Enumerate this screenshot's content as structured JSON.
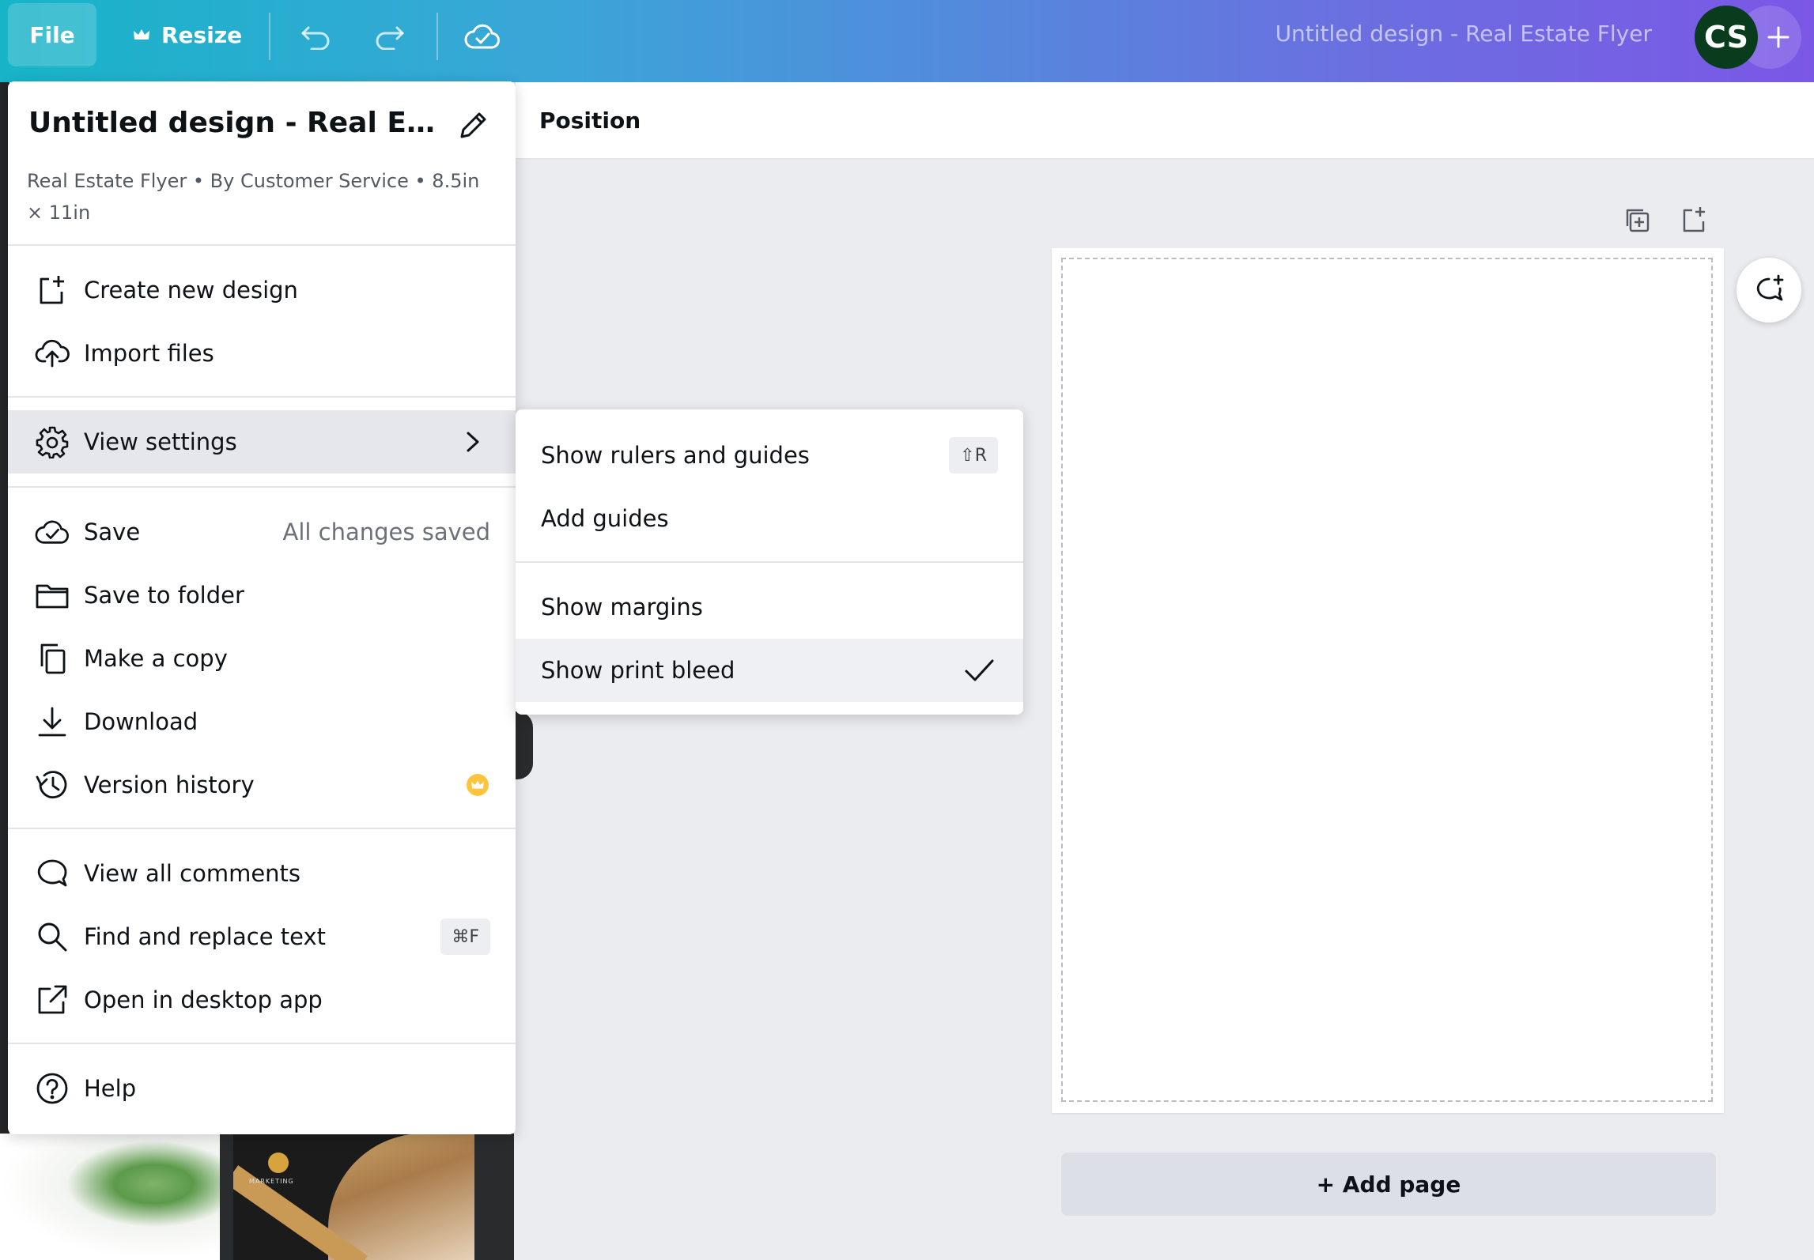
{
  "topbar": {
    "file_label": "File",
    "resize_label": "Resize",
    "document_title": "Untitled design - Real Estate Flyer",
    "avatar_initials": "CS",
    "icons": [
      "crown-icon",
      "undo-icon",
      "redo-icon",
      "cloud-check-icon",
      "plus-icon"
    ]
  },
  "toolbar": {
    "position_label": "Position"
  },
  "file_menu": {
    "title": "Untitled design - Real Estate Flyer",
    "subtitle": "Real Estate Flyer • By Customer Service • 8.5in × 11in",
    "items": {
      "create_new_design": "Create new design",
      "import_files": "Import files",
      "view_settings": "View settings",
      "save": "Save",
      "save_status": "All changes saved",
      "save_to_folder": "Save to folder",
      "make_copy": "Make a copy",
      "download": "Download",
      "version_history": "Version history",
      "view_all_comments": "View all comments",
      "find_replace": "Find and replace text",
      "find_replace_shortcut": "⌘F",
      "open_desktop": "Open in desktop app",
      "help": "Help"
    }
  },
  "view_settings_menu": {
    "show_rulers": "Show rulers and guides",
    "show_rulers_shortcut": "⇧R",
    "add_guides": "Add guides",
    "show_margins": "Show margins",
    "show_print_bleed": "Show print bleed",
    "show_print_bleed_checked": true
  },
  "canvas": {
    "add_page_label": "+ Add page"
  },
  "thumbnails": {
    "marketing_text": "MARKETING"
  },
  "colors": {
    "gradient_start": "#17b4c8",
    "gradient_end": "#7b57e6",
    "avatar_bg": "#083c1d",
    "crown_badge": "#ffc43d"
  }
}
